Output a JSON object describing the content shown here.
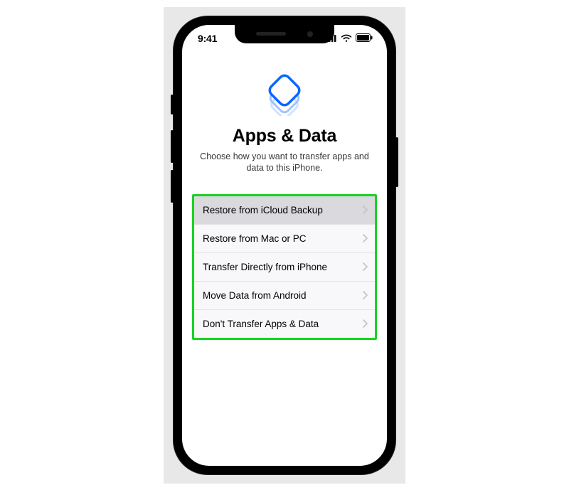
{
  "statusbar": {
    "time": "9:41"
  },
  "screen": {
    "title": "Apps & Data",
    "subtitle": "Choose how you want to transfer apps and data to this iPhone."
  },
  "options": [
    {
      "label": "Restore from iCloud Backup",
      "selected": true
    },
    {
      "label": "Restore from Mac or PC",
      "selected": false
    },
    {
      "label": "Transfer Directly from iPhone",
      "selected": false
    },
    {
      "label": "Move Data from Android",
      "selected": false
    },
    {
      "label": "Don't Transfer Apps & Data",
      "selected": false
    }
  ]
}
